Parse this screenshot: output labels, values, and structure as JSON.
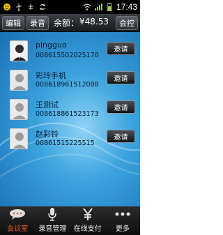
{
  "status_bar": {
    "time": "17:43"
  },
  "top_bar": {
    "edit_label": "编辑",
    "record_label": "录音",
    "balance_label": "余额：",
    "balance_value": "¥48.53",
    "conference_label": "会控"
  },
  "contacts": [
    {
      "name": "pingguo",
      "number": "008615502025170",
      "invite_label": "邀请"
    },
    {
      "name": "彩玲手机",
      "number": "008618961512088",
      "invite_label": "邀请"
    },
    {
      "name": "王测试",
      "number": "008618861523173",
      "invite_label": "邀请"
    },
    {
      "name": "赵彩铃",
      "number": "00861515225515",
      "invite_label": "邀请"
    }
  ],
  "bottom_tabs": [
    {
      "label": "会议室",
      "icon": "chat-bubble-icon",
      "active": true
    },
    {
      "label": "录音管理",
      "icon": "microphone-icon",
      "active": false
    },
    {
      "label": "在线支付",
      "icon": "yen-icon",
      "active": false
    },
    {
      "label": "更多",
      "icon": "more-icon",
      "active": false
    }
  ],
  "colors": {
    "active_tab": "#e35a2a",
    "content_bg": "#3aa3de"
  }
}
